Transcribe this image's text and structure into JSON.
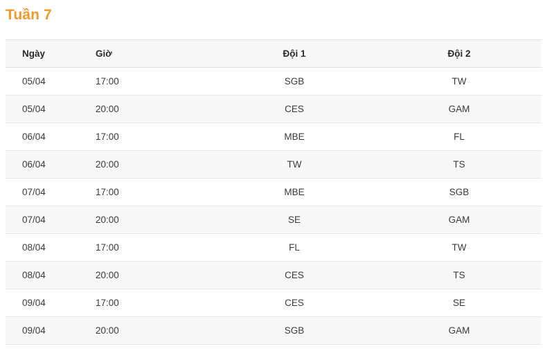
{
  "page": {
    "title": "Tuần 7",
    "title_color": "#ef9a2b"
  },
  "table": {
    "headers": {
      "date": "Ngày",
      "time": "Giờ",
      "team1": "Đội 1",
      "team2": "Đội 2"
    },
    "rows": [
      {
        "date": "05/04",
        "time": "17:00",
        "team1": "SGB",
        "team2": "TW"
      },
      {
        "date": "05/04",
        "time": "20:00",
        "team1": "CES",
        "team2": "GAM"
      },
      {
        "date": "06/04",
        "time": "17:00",
        "team1": "MBE",
        "team2": "FL"
      },
      {
        "date": "06/04",
        "time": "20:00",
        "team1": "TW",
        "team2": "TS"
      },
      {
        "date": "07/04",
        "time": "17:00",
        "team1": "MBE",
        "team2": "SGB"
      },
      {
        "date": "07/04",
        "time": "20:00",
        "team1": "SE",
        "team2": "GAM"
      },
      {
        "date": "08/04",
        "time": "17:00",
        "team1": "FL",
        "team2": "TW"
      },
      {
        "date": "08/04",
        "time": "20:00",
        "team1": "CES",
        "team2": "TS"
      },
      {
        "date": "09/04",
        "time": "17:00",
        "team1": "CES",
        "team2": "SE"
      },
      {
        "date": "09/04",
        "time": "20:00",
        "team1": "SGB",
        "team2": "GAM"
      }
    ]
  },
  "style": {
    "header_bg": "#f8f8f8",
    "stripe_bg": "#f8f8f8",
    "border_color": "#e4e4e4",
    "text_color": "#3a3a3a"
  }
}
